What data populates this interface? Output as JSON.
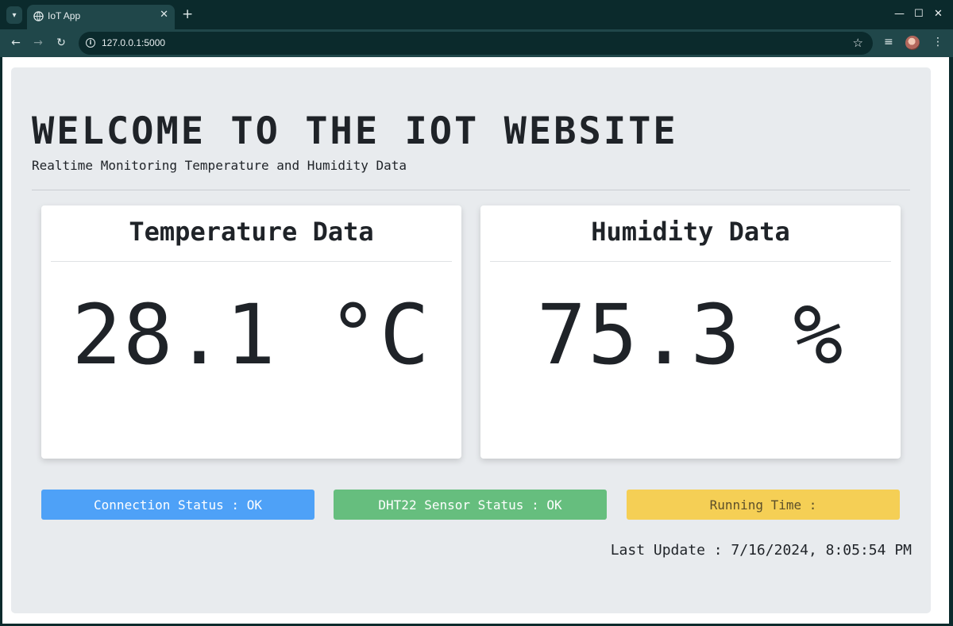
{
  "browser": {
    "tab_title": "IoT App",
    "tab_close": "✕",
    "new_tab": "+",
    "url": "127.0.0.1:5000",
    "window_controls": {
      "minimize": "—",
      "maximize": "☐",
      "close": "✕"
    },
    "icons": [
      "tab-list-icon",
      "globe-icon",
      "back-icon",
      "forward-icon",
      "reload-icon",
      "info-icon",
      "star-icon",
      "reading-list-icon",
      "profile-avatar",
      "menu-icon"
    ]
  },
  "page": {
    "title": "WELCOME TO THE IOT WEBSITE",
    "subtitle": "Realtime Monitoring Temperature and Humidity Data",
    "temperature": {
      "heading": "Temperature Data",
      "value": "28.1 °C"
    },
    "humidity": {
      "heading": "Humidity Data",
      "value": "75.3 %"
    },
    "status": {
      "connection": "Connection Status : OK",
      "sensor": "DHT22 Sensor Status : OK",
      "running": "Running Time :"
    },
    "last_update": "Last Update : 7/16/2024, 8:05:54 PM"
  },
  "colors": {
    "browser_dark": "#0b2a2c",
    "browser_toolbar": "#20474a",
    "page_bg": "#e8ebee",
    "connection_bg": "#4ea1f7",
    "sensor_bg": "#66be7e",
    "running_bg": "#f5cf55",
    "status_text_light": "#ffffff",
    "status_text_dark": "#5c4f2a"
  }
}
